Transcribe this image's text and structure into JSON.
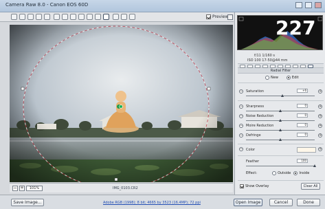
{
  "window": {
    "title": "Camera Raw 8.0 - Canon EOS 60D"
  },
  "toolbar": {
    "tools": [
      "zoom-tool-icon",
      "hand-tool-icon",
      "white-balance-icon",
      "color-sampler-icon",
      "targeted-adjust-icon",
      "crop-icon",
      "straighten-icon",
      "spot-removal-icon",
      "red-eye-icon",
      "adjustment-brush-icon",
      "graduated-filter-icon",
      "radial-filter-icon",
      "preferences-icon",
      "rotate-ccw-icon",
      "rotate-cw-icon"
    ],
    "preview_label": "Preview"
  },
  "overlay_number": "227",
  "histogram": {
    "camera_info": [
      "f/11   1/160 s",
      "ISO 100   17-50@44 mm"
    ]
  },
  "panel": {
    "title": "Radial Filter",
    "modes": {
      "new": "New",
      "edit": "Edit",
      "selected": "edit"
    },
    "sliders": [
      {
        "label": "Saturation",
        "value": "+6",
        "pos": 0.53
      },
      {
        "label": "Sharpness",
        "value": "0",
        "pos": 0.5
      },
      {
        "label": "Noise Reduction",
        "value": "0",
        "pos": 0.5
      },
      {
        "label": "Moire Reduction",
        "value": "0",
        "pos": 0.5
      },
      {
        "label": "Defringe",
        "value": "0",
        "pos": 0.5
      }
    ],
    "color_label": "Color",
    "feather": {
      "label": "Feather",
      "value": "100",
      "pos": 1.0
    },
    "effect_label": "Effect:",
    "effect_outside": "Outside",
    "effect_inside": "Inside",
    "effect_selected": "inside",
    "show_overlay": "Show Overlay",
    "clear_all": "Clear All"
  },
  "status": {
    "zoom_value": "101%",
    "filename": "IMG_0103.CR2"
  },
  "bottom": {
    "save_image": "Save Image...",
    "workflow_link": "Adobe RGB (1998); 8 bit; 4665 by 3523 (16.4MP); 72 ppi",
    "open_image": "Open Image",
    "cancel": "Cancel",
    "done": "Done"
  }
}
